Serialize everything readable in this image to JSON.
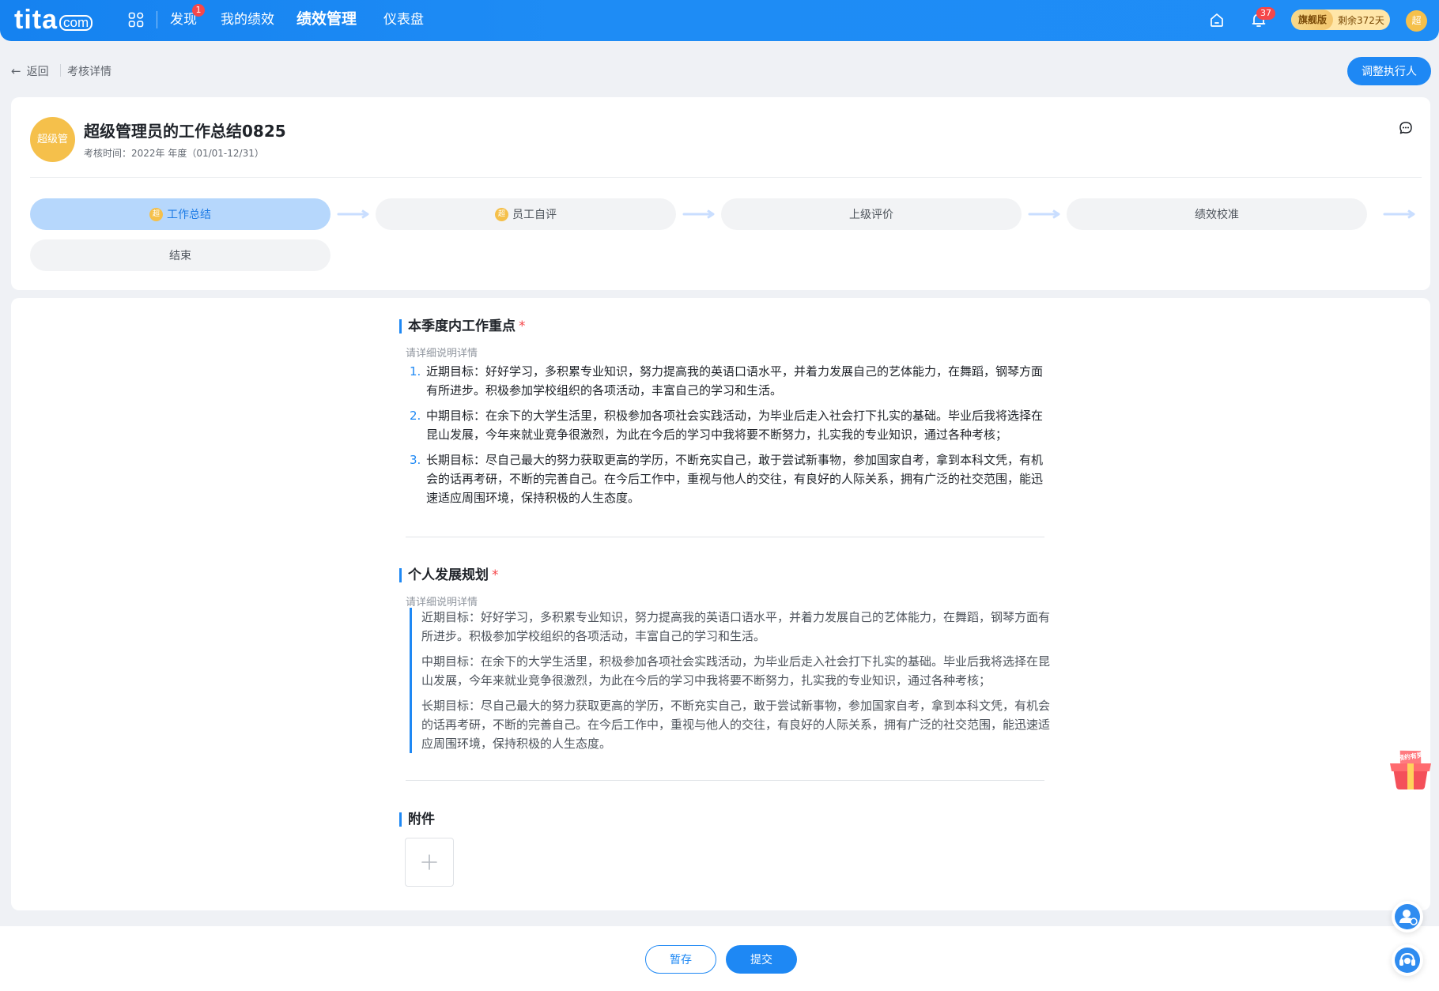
{
  "topbar": {
    "logo_main": "tita",
    "logo_suffix": "com",
    "nav": [
      {
        "label": "发现",
        "badge": "1"
      },
      {
        "label": "我的绩效"
      },
      {
        "label": "绩效管理",
        "active": true
      },
      {
        "label": "仪表盘"
      }
    ],
    "bell_badge": "37",
    "plan_name": "旗舰版",
    "plan_remaining": "剩余372天",
    "avatar_text": "超",
    "accent_color": "#1e88f4"
  },
  "breadcrumb": {
    "back_label": "返回",
    "current": "考核详情"
  },
  "actions": {
    "adjust_label": "调整执行人"
  },
  "header": {
    "avatar_text": "超级管",
    "title": "超级管理员的工作总结0825",
    "time_label": "考核时间：2022年 年度（01/01-12/31）"
  },
  "steps": [
    {
      "label": "工作总结",
      "avatar": "超",
      "active": true
    },
    {
      "label": "员工自评",
      "avatar": "超"
    },
    {
      "label": "上级评价"
    },
    {
      "label": "绩效校准"
    },
    {
      "label": "结束"
    }
  ],
  "sections": {
    "focus": {
      "title": "本季度内工作重点",
      "required": "*",
      "hint": "请详细说明详情",
      "items": [
        {
          "num": "1.",
          "text": "近期目标：好好学习，多积累专业知识，努力提高我的英语口语水平，并着力发展自己的艺体能力，在舞蹈，钢琴方面有所进步。积极参加学校组织的各项活动，丰富自己的学习和生活。"
        },
        {
          "num": "2.",
          "text": "中期目标：在余下的大学生活里，积极参加各项社会实践活动，为毕业后走入社会打下扎实的基础。毕业后我将选择在昆山发展，今年来就业竞争很激烈，为此在今后的学习中我将要不断努力，扎实我的专业知识，通过各种考核；"
        },
        {
          "num": "3.",
          "text": "长期目标：尽自己最大的努力获取更高的学历，不断充实自己，敢于尝试新事物，参加国家自考，拿到本科文凭，有机会的话再考研，不断的完善自己。在今后工作中，重视与他人的交往，有良好的人际关系，拥有广泛的社交范围，能迅速适应周围环境，保持积极的人生态度。"
        }
      ]
    },
    "plan": {
      "title": "个人发展规划",
      "required": "*",
      "hint": "请详细说明详情",
      "paragraphs": [
        "近期目标：好好学习，多积累专业知识，努力提高我的英语口语水平，并着力发展自己的艺体能力，在舞蹈，钢琴方面有所进步。积极参加学校组织的各项活动，丰富自己的学习和生活。",
        "中期目标：在余下的大学生活里，积极参加各项社会实践活动，为毕业后走入社会打下扎实的基础。毕业后我将选择在昆山发展，今年来就业竞争很激烈，为此在今后的学习中我将要不断努力，扎实我的专业知识，通过各种考核；",
        "长期目标：尽自己最大的努力获取更高的学历，不断充实自己，敢于尝试新事物，参加国家自考，拿到本科文凭，有机会的话再考研，不断的完善自己。在今后工作中，重视与他人的交往，有良好的人际关系，拥有广泛的社交范围，能迅速适应周围环境，保持积极的人生态度。"
      ]
    },
    "attachment": {
      "title": "附件",
      "add_icon": "plus-icon"
    }
  },
  "footer": {
    "save_label": "暂存",
    "submit_label": "提交"
  },
  "widgets": {
    "gift_text": "预约有奖"
  }
}
